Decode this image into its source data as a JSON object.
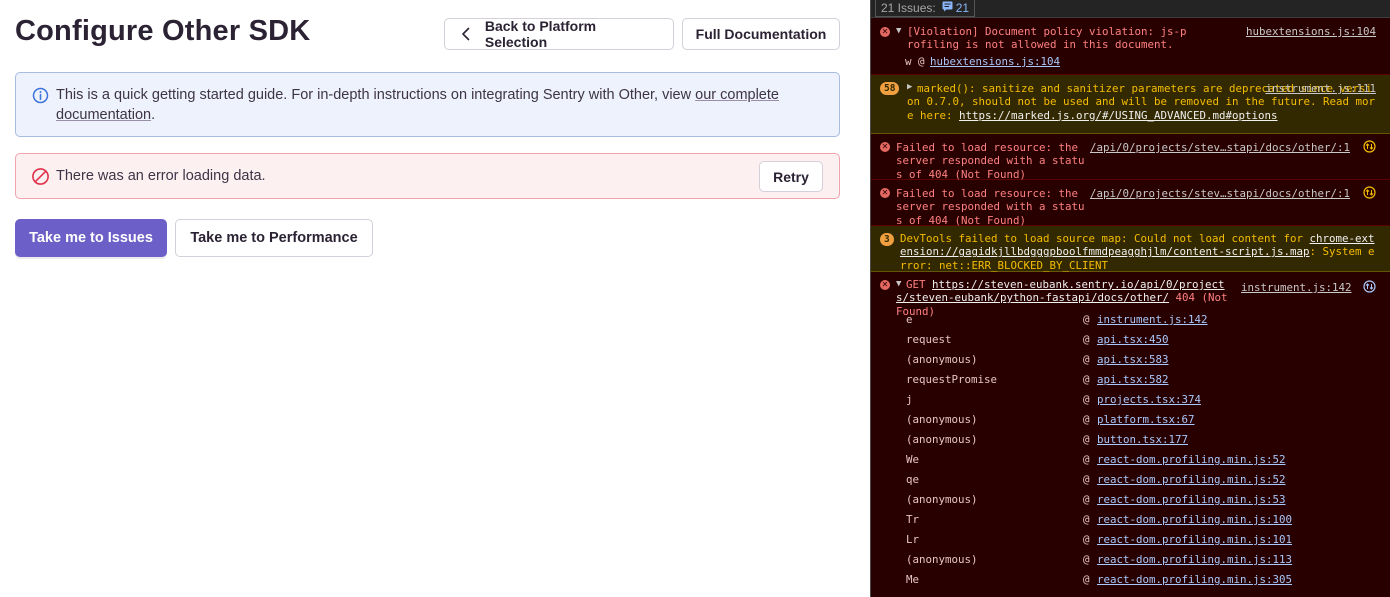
{
  "app": {
    "page_title": "Configure Other SDK",
    "back_button": "Back to Platform Selection",
    "docs_button": "Full Documentation",
    "info_alert": {
      "text_before": "This is a quick getting started guide. For in-depth instructions on integrating Sentry with Other, view ",
      "link_text": "our complete documentation",
      "text_after": "."
    },
    "error_alert": {
      "text": "There was an error loading data.",
      "retry_label": "Retry"
    },
    "primary_button": "Take me to Issues",
    "secondary_button": "Take me to Performance",
    "colors": {
      "accent": "#6c5fc7",
      "error_border": "#f1a3ae",
      "info_border": "#a8bbe0"
    }
  },
  "devtools": {
    "issues_label": "21 Issues:",
    "issues_count": "21",
    "messages": [
      {
        "kind": "error",
        "text": "[Violation] Document policy violation: js-profiling is not allowed in this document.",
        "source": "hubextensions.js:104",
        "sub_prefix": "w @ ",
        "sub_link": "hubextensions.js:104"
      },
      {
        "kind": "warning",
        "count": "58",
        "text": "marked(): sanitize and sanitizer parameters are deprecated since version 0.7.0, should not be used and will be removed in the future. Read more here: ",
        "link": "https://marked.js.org/#/USING_ADVANCED.md#options",
        "source": "instrument.js:111"
      },
      {
        "kind": "error",
        "text": "Failed to load resource: the server responded with a status of 404 (Not Found)",
        "source": "/api/0/projects/stev…stapi/docs/other/:1"
      },
      {
        "kind": "error",
        "text": "Failed to load resource: the server responded with a status of 404 (Not Found)",
        "source": "/api/0/projects/stev…stapi/docs/other/:1"
      },
      {
        "kind": "warning",
        "count": "3",
        "text": "DevTools failed to load source map: Could not load content for ",
        "link": "chrome-extension://gagidkjllbdgggpboolfmmdpeagghjlm/content-script.js.map",
        "text_after": ": System error: net::ERR_BLOCKED_BY_CLIENT"
      },
      {
        "kind": "error",
        "method": "GET",
        "link": "https://steven-eubank.sentry.io/api/0/projects/steven-eubank/python-fastapi/docs/other/",
        "text_after": " 404 (Not Found)",
        "source": "instrument.js:142"
      }
    ],
    "stack": [
      {
        "fn": "e",
        "loc": "instrument.js:142"
      },
      {
        "fn": "request",
        "loc": "api.tsx:450"
      },
      {
        "fn": "(anonymous)",
        "loc": "api.tsx:583"
      },
      {
        "fn": "requestPromise",
        "loc": "api.tsx:582"
      },
      {
        "fn": "j",
        "loc": "projects.tsx:374"
      },
      {
        "fn": "(anonymous)",
        "loc": "platform.tsx:67"
      },
      {
        "fn": "(anonymous)",
        "loc": "button.tsx:177"
      },
      {
        "fn": "We",
        "loc": "react-dom.profiling.min.js:52"
      },
      {
        "fn": "qe",
        "loc": "react-dom.profiling.min.js:52"
      },
      {
        "fn": "(anonymous)",
        "loc": "react-dom.profiling.min.js:53"
      },
      {
        "fn": "Tr",
        "loc": "react-dom.profiling.min.js:100"
      },
      {
        "fn": "Lr",
        "loc": "react-dom.profiling.min.js:101"
      },
      {
        "fn": "(anonymous)",
        "loc": "react-dom.profiling.min.js:113"
      },
      {
        "fn": "Me",
        "loc": "react-dom.profiling.min.js:305"
      }
    ],
    "at_symbol": "@",
    "colors": {
      "background": "#290000",
      "warning_bg": "#332900",
      "error_text": "#ff8080",
      "warning_text": "#f5bd00",
      "link": "#a8c7fa"
    }
  }
}
